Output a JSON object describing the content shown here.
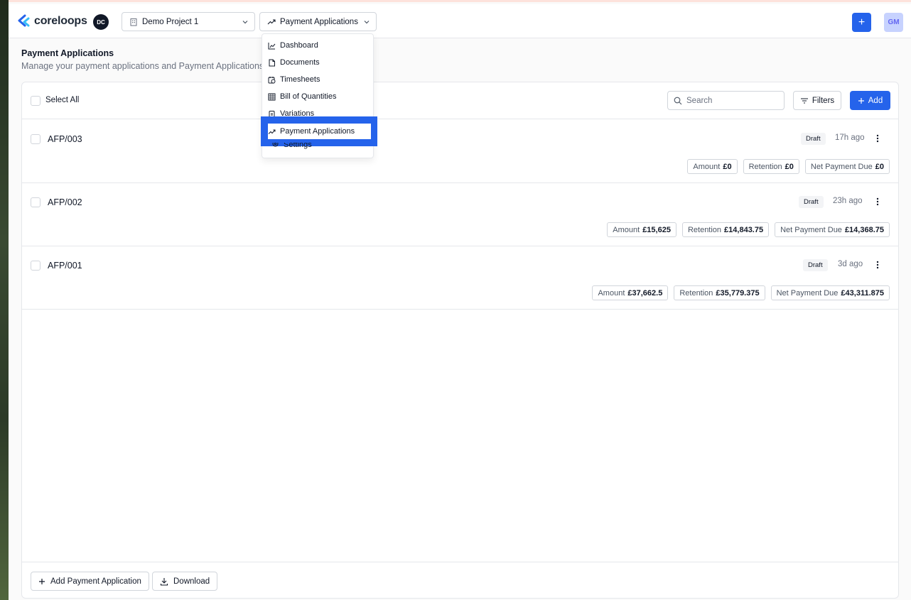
{
  "app": {
    "logo_text": "coreloops",
    "project_avatar": "DC",
    "user_avatar": "GM",
    "accent": "#2563eb"
  },
  "topbar": {
    "project_select": "Demo Project 1",
    "module_select": "Payment Applications",
    "plus_label": "+"
  },
  "dropdown": {
    "items": [
      {
        "label": "Dashboard",
        "icon": "chart-line-icon"
      },
      {
        "label": "Documents",
        "icon": "file-icon"
      },
      {
        "label": "Timesheets",
        "icon": "clock-calendar-icon"
      },
      {
        "label": "Bill of Quantities",
        "icon": "table-icon"
      },
      {
        "label": "Variations",
        "icon": "clipboard-icon"
      },
      {
        "label": "Payment Applications",
        "icon": "trending-up-icon",
        "selected": true
      },
      {
        "label": "Settings",
        "icon": "gear-icon"
      }
    ]
  },
  "page": {
    "title": "Payment Applications",
    "subtitle": "Manage your payment applications and Payment Applications"
  },
  "toolbar": {
    "select_all": "Select All",
    "search_placeholder": "Search",
    "filters_label": "Filters",
    "add_label": "Add"
  },
  "rows": [
    {
      "title": "AFP/003",
      "status": "Draft",
      "time": "17h ago",
      "amount_label": "Amount",
      "amount": "£0",
      "retention_label": "Retention",
      "retention": "£0",
      "net_label": "Net Payment Due",
      "net": "£0"
    },
    {
      "title": "AFP/002",
      "status": "Draft",
      "time": "23h ago",
      "amount_label": "Amount",
      "amount": "£15,625",
      "retention_label": "Retention",
      "retention": "£14,843.75",
      "net_label": "Net Payment Due",
      "net": "£14,368.75"
    },
    {
      "title": "AFP/001",
      "status": "Draft",
      "time": "3d ago",
      "amount_label": "Amount",
      "amount": "£37,662.5",
      "retention_label": "Retention",
      "retention": "£35,779.375",
      "net_label": "Net Payment Due",
      "net": "£43,311.875"
    }
  ],
  "footer": {
    "add_label": "Add Payment Application",
    "download_label": "Download"
  }
}
